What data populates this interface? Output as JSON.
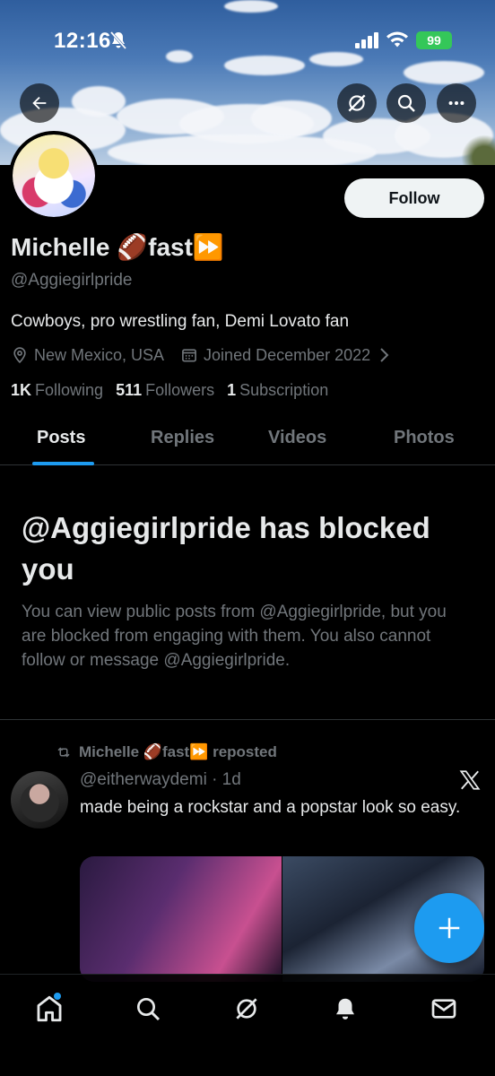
{
  "status_bar": {
    "time": "12:16",
    "battery": "99"
  },
  "profile": {
    "follow_label": "Follow",
    "name": "Michelle 🏈fast⏩",
    "handle": "@Aggiegirlpride",
    "bio": "Cowboys, pro wrestling fan, Demi Lovato fan",
    "location": "New Mexico, USA",
    "joined": "Joined December 2022",
    "following_count": "1K",
    "following_label": "Following",
    "followers_count": "511",
    "followers_label": "Followers",
    "subscriptions_count": "1",
    "subscriptions_label": "Subscription"
  },
  "tabs": [
    {
      "label": "Posts",
      "active": true
    },
    {
      "label": "Replies"
    },
    {
      "label": "Videos"
    },
    {
      "label": "Photos"
    }
  ],
  "blocked": {
    "title": "@Aggiegirlpride has blocked you",
    "text": "You can view public posts from @Aggiegirlpride, but you are blocked from engaging with them. You also cannot follow or message @Aggiegirlpride."
  },
  "post": {
    "repost_label": "Michelle 🏈fast⏩ reposted",
    "user_time": "@eitherwaydemi · 1d",
    "text": "made being a rockstar and a popstar look so easy."
  },
  "icons": {
    "back": "arrow-left-icon",
    "grok": "grok-icon",
    "search": "search-icon",
    "more": "more-icon",
    "nav": [
      "home-icon",
      "search-icon",
      "grok-icon",
      "bell-icon",
      "mail-icon"
    ]
  },
  "colors": {
    "accent": "#1d9bf0",
    "battery": "#34c759"
  }
}
